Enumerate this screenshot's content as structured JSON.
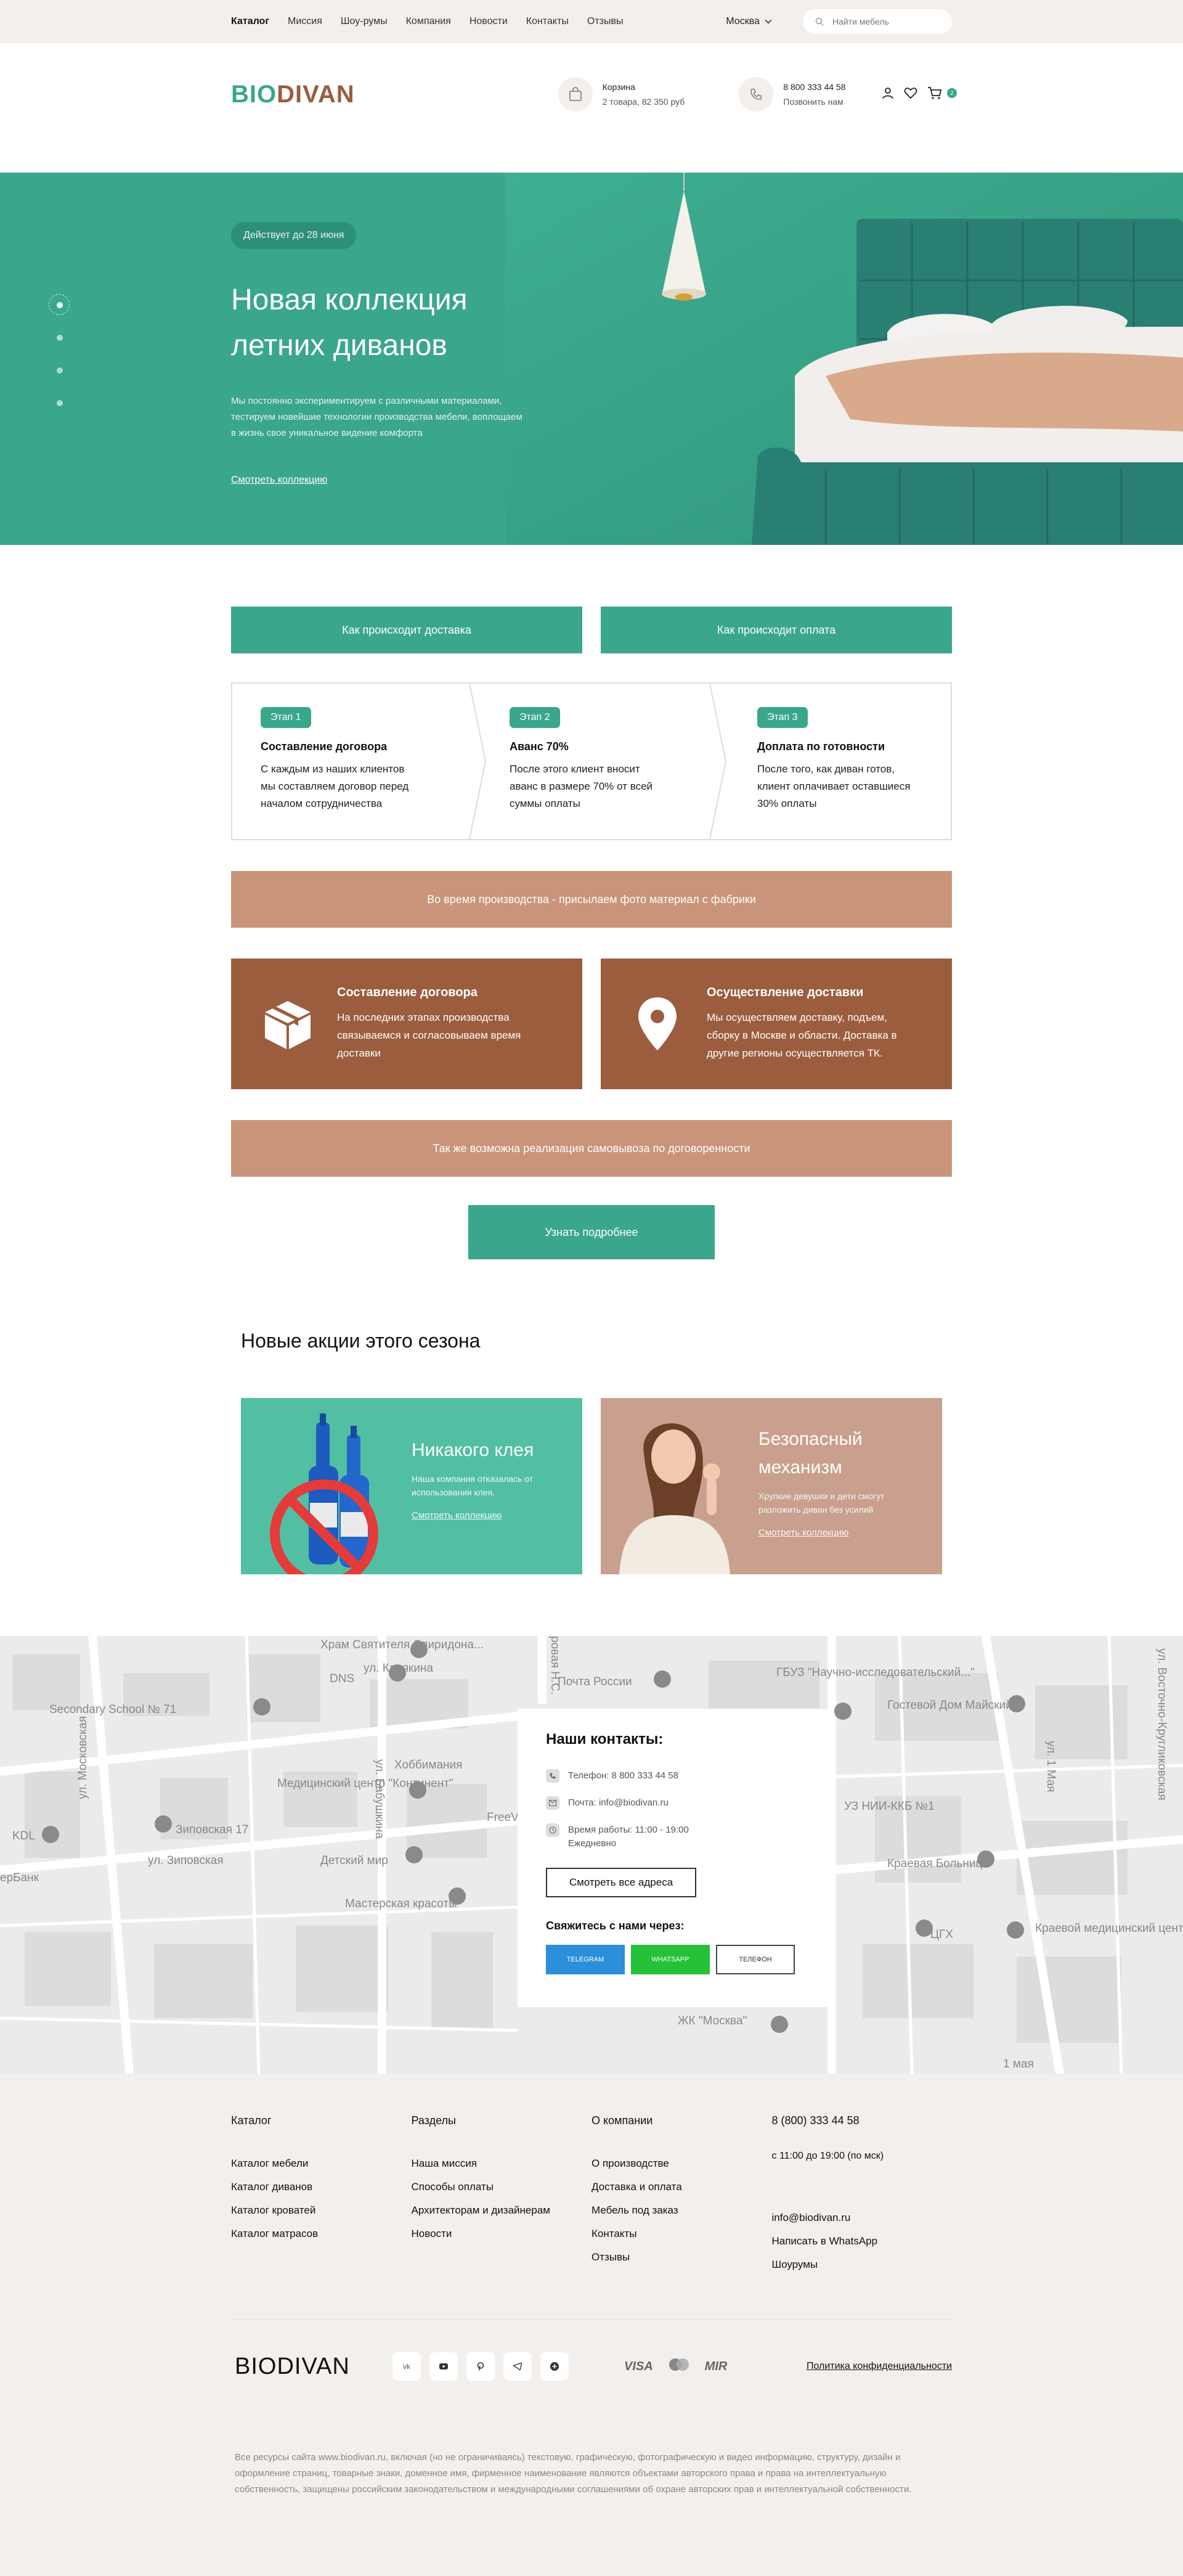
{
  "topbar": {
    "nav": [
      "Каталог",
      "Миссия",
      "Шоу-румы",
      "Компания",
      "Новости",
      "Контакты",
      "Отзывы"
    ],
    "city": "Москва",
    "search_placeholder": "Найти мебель"
  },
  "header": {
    "logo_bio": "BIO",
    "logo_divan": "DIVAN",
    "cart_title": "Корзина",
    "cart_sub": "2 товара, 82 350 руб",
    "phone": "8 800 333 44 58",
    "call": "Позвонить нам",
    "cart_count": "2"
  },
  "hero": {
    "badge": "Действует до 28 июня",
    "title_line1": "Новая коллекция",
    "title_line2": "летних диванов",
    "text": "Мы постоянно экспериментируем с различными материалами, тестируем новейшие технологии производства мебели, воплощаем в жизнь свое уникальное видение комфорта",
    "link": "Смотреть коллекцию"
  },
  "steps": {
    "tab_delivery": "Как происходит доставка",
    "tab_payment": "Как происходит оплата",
    "stages": [
      {
        "tag": "Этап 1",
        "title": "Составление договора",
        "text": "С каждым из наших клиентов мы составляем договор перед началом сотрудничества"
      },
      {
        "tag": "Этап 2",
        "title": "Аванс 70%",
        "text": "После этого клиент вносит аванс в размере 70% от всей суммы оплаты"
      },
      {
        "tag": "Этап 3",
        "title": "Доплата по готовности",
        "text": "После того, как диван готов, клиент оплачивает оставшиеся 30% оплаты"
      }
    ],
    "bar1": "Во время производства - присылаем фото материал с фабрики",
    "cards": [
      {
        "title": "Составление договора",
        "text": "На последних этапах производства связываемся и согласовываем время доставки"
      },
      {
        "title": "Осуществление доставки",
        "text": "Мы осуществляем доставку, подъем, сборку в Москве и области. Доставка в другие регионы осуществляется ТК."
      }
    ],
    "bar2": "Так же возможна реализация самовывоза по договоренности",
    "cta": "Узнать подробнее"
  },
  "promos": {
    "title": "Новые акции этого сезона",
    "items": [
      {
        "title": "Никакого клея",
        "text": "Наша компания отказалась от использования клея.",
        "link": "Смотреть коллекцию"
      },
      {
        "title": "Безопасный механизм",
        "text": "Хрупкие девушки и дети смогут разложить диван без усилий",
        "link": "Смотреть коллекцию"
      }
    ]
  },
  "map": {
    "labels": [
      "Храм Святителя Спиридона...",
      "DNS",
      "ул. Карякина",
      "Почта России",
      "ГБУЗ \"Научно-исследовательский...\"",
      "Гостевой Дом Майский",
      "Secondary School № 71",
      "Медицинский центр \"Континент\"",
      "Хоббимания",
      "Зиповская 17",
      "ул. Зиповская",
      "Детский мир",
      "Мастерская красоты",
      "KDL",
      "ерБанк",
      "ул. Московская",
      "ул. Бабушкина",
      "FreeVap",
      "ул. 1 Мая",
      "Краевая Больница",
      "Краевой медицинский центр",
      "ЦГХ",
      "ЖК \"Москва\"",
      "ул. Восточно-Кругликовская",
      "УЗ НИИ-ККБ №1",
      "1 мая",
      "ровая Н.С."
    ]
  },
  "contacts": {
    "title": "Наши контакты:",
    "phone": "Телефон: 8 800 333 44 58",
    "email": "Почта: info@biodivan.ru",
    "hours": "Время работы: 11:00 - 19:00",
    "hours_sub": "Ежедневно",
    "all_addresses": "Смотреть все адреса",
    "contact_us": "Свяжитесь с нами через:",
    "telegram": "TELEGRAM",
    "whatsapp": "WHATSAPP",
    "phone_btn": "ТЕЛЕФОН"
  },
  "footer": {
    "col1": {
      "title": "Каталог",
      "items": [
        "Каталог мебели",
        "Каталог диванов",
        "Каталог кроватей",
        "Каталог матрасов"
      ]
    },
    "col2": {
      "title": "Разделы",
      "items": [
        "Наша миссия",
        "Способы оплаты",
        "Архитекторам и дизайнерам",
        "Новости"
      ]
    },
    "col3": {
      "title": "О компании",
      "items": [
        "О производстве",
        "Доставка и оплата",
        "Мебель под заказ",
        "Контакты",
        "Отзывы"
      ]
    },
    "col4": {
      "phone": "8 (800) 333 44 58",
      "hours": "с 11:00 до 19:00 (по мск)",
      "items": [
        "info@biodivan.ru",
        "Написать в WhatsApp",
        "Шоурумы"
      ]
    },
    "logo": "BIODIVAN",
    "social": [
      "vk",
      "youtube",
      "pinterest",
      "telegram",
      "plus"
    ],
    "pay": [
      "VISA",
      "MIR"
    ],
    "policy": "Политика конфиденциальности",
    "copyright": "Все ресурсы сайта www.biodivan.ru, включая (но не ограничиваясь) текстовую, графическую, фотографическую и видео информацию, структуру, дизайн и оформление страниц, товарные знаки, доменное имя, фирменное наименование являются объектами авторского права и права на интеллектуальную собственность, защищены российским законодательством и международными соглашениями об охране авторских прав и интеллектуальной собственности."
  },
  "colors": {
    "green": "#3aa68c",
    "brown": "#9b5d3e",
    "tan": "#c99479",
    "beige": "#f3efec"
  }
}
